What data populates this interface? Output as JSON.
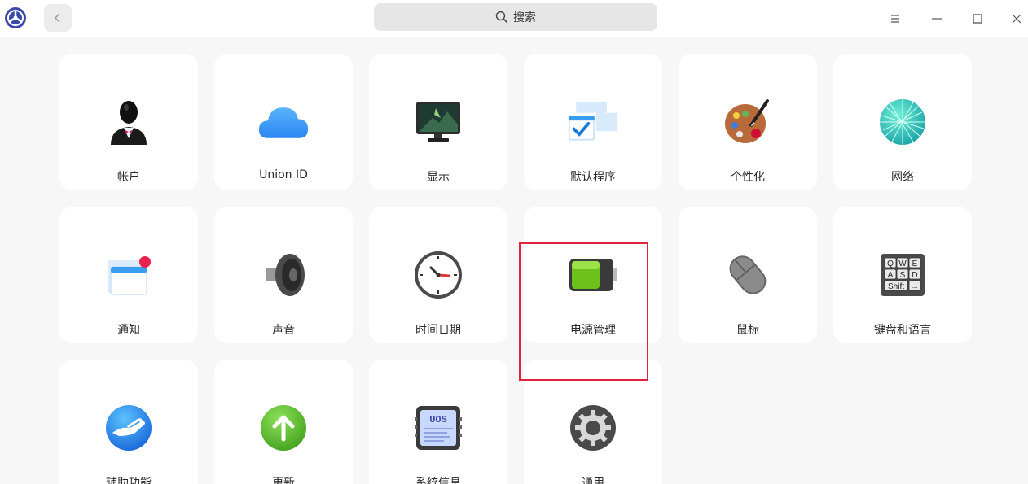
{
  "titlebar": {
    "search_placeholder": "搜索",
    "icons": {
      "logo": "control-center-logo-icon",
      "back": "chevron-left-icon",
      "search": "search-icon",
      "menu": "hamburger-menu-icon",
      "minimize": "minimize-icon",
      "maximize": "maximize-icon",
      "close": "close-icon"
    }
  },
  "modules": [
    {
      "label": "帐户",
      "icon": "account-icon"
    },
    {
      "label": "Union ID",
      "icon": "cloud-icon"
    },
    {
      "label": "显示",
      "icon": "display-monitor-icon"
    },
    {
      "label": "默认程序",
      "icon": "default-apps-icon"
    },
    {
      "label": "个性化",
      "icon": "palette-icon"
    },
    {
      "label": "网络",
      "icon": "network-globe-icon"
    },
    {
      "label": "通知",
      "icon": "notification-icon"
    },
    {
      "label": "声音",
      "icon": "speaker-icon"
    },
    {
      "label": "时间日期",
      "icon": "clock-icon"
    },
    {
      "label": "电源管理",
      "icon": "battery-icon"
    },
    {
      "label": "鼠标",
      "icon": "mouse-icon"
    },
    {
      "label": "键盘和语言",
      "icon": "keyboard-icon"
    },
    {
      "label": "辅助功能",
      "icon": "accessibility-hand-icon"
    },
    {
      "label": "更新",
      "icon": "update-arrow-icon"
    },
    {
      "label": "系统信息",
      "icon": "system-info-uos-icon"
    },
    {
      "label": "通用",
      "icon": "general-gear-icon"
    }
  ],
  "keyboard_keys": [
    "Q",
    "W",
    "E",
    "A",
    "S",
    "D",
    "Shift",
    "→"
  ],
  "sysinfo_text": "UOS",
  "highlight": {
    "target": "电源管理",
    "color": "#e0243d"
  }
}
